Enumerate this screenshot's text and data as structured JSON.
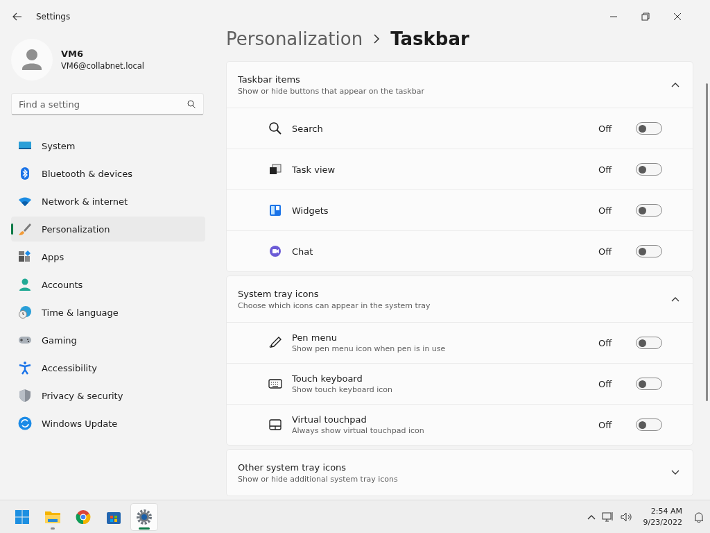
{
  "window": {
    "title": "Settings"
  },
  "user": {
    "name": "VM6",
    "email": "VM6@collabnet.local"
  },
  "search": {
    "placeholder": "Find a setting"
  },
  "nav": [
    {
      "label": "System",
      "kind": "system",
      "selected": false
    },
    {
      "label": "Bluetooth & devices",
      "kind": "bluetooth",
      "selected": false
    },
    {
      "label": "Network & internet",
      "kind": "network",
      "selected": false
    },
    {
      "label": "Personalization",
      "kind": "brush",
      "selected": true
    },
    {
      "label": "Apps",
      "kind": "apps",
      "selected": false
    },
    {
      "label": "Accounts",
      "kind": "accounts",
      "selected": false
    },
    {
      "label": "Time & language",
      "kind": "time",
      "selected": false
    },
    {
      "label": "Gaming",
      "kind": "gaming",
      "selected": false
    },
    {
      "label": "Accessibility",
      "kind": "accessibility",
      "selected": false
    },
    {
      "label": "Privacy & security",
      "kind": "privacy",
      "selected": false
    },
    {
      "label": "Windows Update",
      "kind": "update",
      "selected": false
    }
  ],
  "breadcrumb": {
    "parent": "Personalization",
    "current": "Taskbar"
  },
  "sections": [
    {
      "title": "Taskbar items",
      "subtitle": "Show or hide buttons that appear on the taskbar",
      "expanded": true,
      "items": [
        {
          "label": "Search",
          "kind": "search",
          "state": "Off",
          "on": false
        },
        {
          "label": "Task view",
          "kind": "taskview",
          "state": "Off",
          "on": false
        },
        {
          "label": "Widgets",
          "kind": "widgets",
          "state": "Off",
          "on": false
        },
        {
          "label": "Chat",
          "kind": "chat",
          "state": "Off",
          "on": false
        }
      ]
    },
    {
      "title": "System tray icons",
      "subtitle": "Choose which icons can appear in the system tray",
      "expanded": true,
      "items": [
        {
          "label": "Pen menu",
          "description": "Show pen menu icon when pen is in use",
          "kind": "pen",
          "state": "Off",
          "on": false
        },
        {
          "label": "Touch keyboard",
          "description": "Show touch keyboard icon",
          "kind": "keyboard",
          "state": "Off",
          "on": false
        },
        {
          "label": "Virtual touchpad",
          "description": "Always show virtual touchpad icon",
          "kind": "touchpad",
          "state": "Off",
          "on": false
        }
      ]
    },
    {
      "title": "Other system tray icons",
      "subtitle": "Show or hide additional system tray icons",
      "expanded": false
    }
  ],
  "taskbar": {
    "apps": [
      {
        "kind": "start",
        "running": false,
        "active": false
      },
      {
        "kind": "explorer",
        "running": true,
        "active": false
      },
      {
        "kind": "chrome",
        "running": false,
        "active": false
      },
      {
        "kind": "store",
        "running": false,
        "active": false
      },
      {
        "kind": "settings",
        "running": true,
        "active": true
      }
    ],
    "time": "2:54 AM",
    "date": "9/23/2022"
  }
}
